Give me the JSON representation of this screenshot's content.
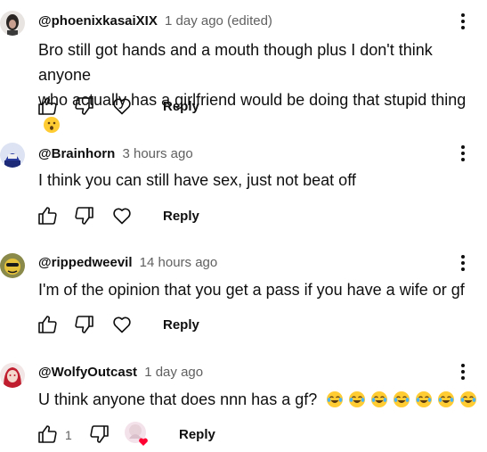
{
  "comments": [
    {
      "author": "@phoenixkasaiXIX",
      "time": "1 day ago (edited)",
      "text_line1": "Bro still got hands and a mouth though plus I don't think anyone",
      "text_line2": "who actually has a girlfriend would be doing that stupid thing",
      "reply": "Reply"
    },
    {
      "author": "@Brainhorn",
      "time": "3 hours ago",
      "text": "I think you can still have sex, just not beat off",
      "reply": "Reply"
    },
    {
      "author": "@rippedweevil",
      "time": "14 hours ago",
      "text": "I'm of the opinion that you get a pass if you have a wife or gf",
      "reply": "Reply"
    },
    {
      "author": "@WolfyOutcast",
      "time": "1 day ago",
      "text": "U think anyone that does nnn has a gf?",
      "like_count": "1",
      "reply": "Reply"
    }
  ],
  "icons": [
    "like-icon",
    "dislike-icon",
    "heart-icon",
    "more-vert-icon",
    "laughing-emoji",
    "hushed-emoji"
  ]
}
